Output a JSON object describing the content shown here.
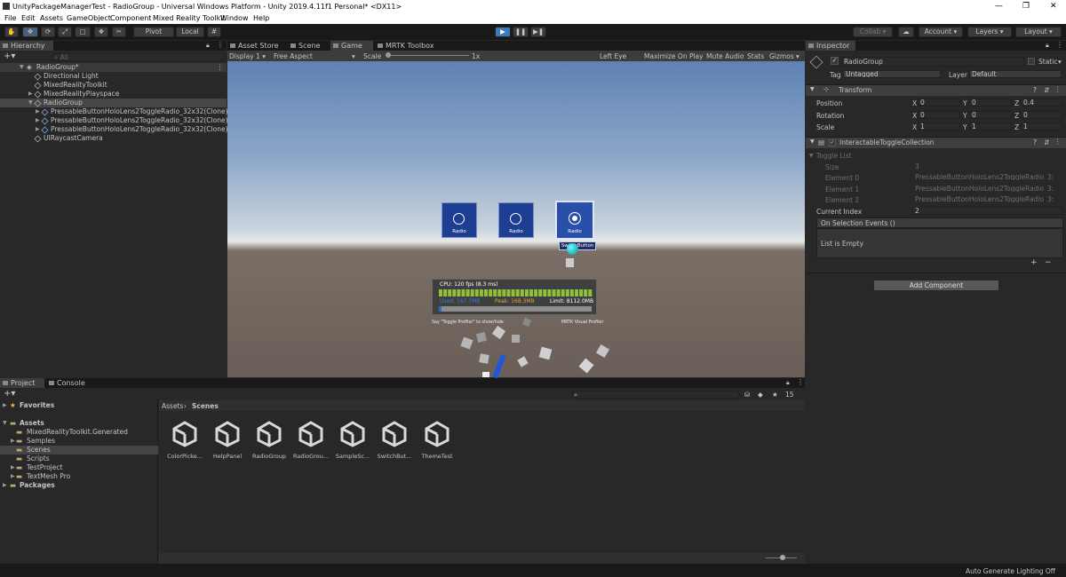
{
  "window": {
    "title": "UnityPackageManagerTest - RadioGroup - Universal Windows Platform - Unity 2019.4.11f1 Personal* <DX11>",
    "min": "—",
    "max": "❐",
    "close": "✕"
  },
  "menu": [
    "File",
    "Edit",
    "Assets",
    "GameObject",
    "Component",
    "Mixed Reality Toolkit",
    "Window",
    "Help"
  ],
  "toolbar": {
    "pivot": "Pivot",
    "local": "Local",
    "collab": "Collab ▾",
    "account": "Account",
    "layers": "Layers",
    "layout": "Layout"
  },
  "hierarchy": {
    "tab": "Hierarchy",
    "search_placeholder": "All",
    "root": "RadioGroup*",
    "items": [
      "Directional Light",
      "MixedRealityToolkit",
      "MixedRealityPlayspace",
      "RadioGroup",
      "PressableButtonHoloLens2ToggleRadio_32x32(Clone)",
      "PressableButtonHoloLens2ToggleRadio_32x32(Clone)",
      "PressableButtonHoloLens2ToggleRadio_32x32(Clone)",
      "UIRaycastCamera"
    ]
  },
  "center_tabs": [
    "Asset Store",
    "Scene",
    "Game",
    "MRTK Toolbox"
  ],
  "game_bar": {
    "display": "Display 1",
    "aspect": "Free Aspect",
    "scale_label": "Scale",
    "scale_value": "1x",
    "eye": "Left Eye",
    "maximize": "Maximize On Play",
    "mute": "Mute Audio",
    "stats": "Stats",
    "gizmos": "Gizmos"
  },
  "game_view": {
    "button_labels": [
      "Radio",
      "Radio",
      "Radio"
    ],
    "switch_tooltip": "SwitchButton",
    "profiler": {
      "cpu": "CPU: 120 fps (8.3 ms)",
      "used": "Used: 167.7MB",
      "peak": "Peak: 168.3MB",
      "limit": "Limit: 8112.0MB",
      "left_caption": "Say \"Toggle Profiler\" to show/hide",
      "right_caption": "MRTK Visual Profiler",
      "fps_fraction": 1.0,
      "memory_fraction": 0.02
    },
    "sky_top": "#6f8fb8",
    "ground": "#6a5f58"
  },
  "inspector": {
    "tab": "Inspector",
    "object_name": "RadioGroup",
    "static_label": "Static",
    "tag_label": "Tag",
    "tag_value": "Untagged",
    "layer_label": "Layer",
    "layer_value": "Default",
    "transform": {
      "title": "Transform",
      "rows": [
        {
          "label": "Position",
          "x": "0",
          "y": "0",
          "z": "0.4"
        },
        {
          "label": "Rotation",
          "x": "0",
          "y": "0",
          "z": "0"
        },
        {
          "label": "Scale",
          "x": "1",
          "y": "1",
          "z": "1"
        }
      ]
    },
    "component": {
      "title": "InteractableToggleCollection",
      "toggle_list": "Toggle List",
      "size_label": "Size",
      "size_value": "3",
      "elements": [
        {
          "label": "Element 0",
          "value": "PressableButtonHoloLens2ToggleRadio_3:"
        },
        {
          "label": "Element 1",
          "value": "PressableButtonHoloLens2ToggleRadio_3:"
        },
        {
          "label": "Element 2",
          "value": "PressableButtonHoloLens2ToggleRadio_3:"
        }
      ],
      "current_index_label": "Current Index",
      "current_index_value": "2",
      "events_label": "On Selection Events ()",
      "list_empty": "List is Empty"
    },
    "add_component": "Add Component"
  },
  "bottom": {
    "tabs": [
      "Project",
      "Console"
    ],
    "favorites": "Favorites",
    "assets": "Assets",
    "asset_folders": [
      "MixedRealityToolkit.Generated",
      "Samples",
      "Scenes",
      "Scripts",
      "TestProject",
      "TextMesh Pro"
    ],
    "packages": "Packages",
    "breadcrumb": [
      "Assets",
      "Scenes"
    ],
    "scene_files": [
      "ColorPicke...",
      "HelpPanel",
      "RadioGroup",
      "RadioGrou...",
      "SampleSc...",
      "SwitchBut...",
      "ThemeTest"
    ],
    "count": "15"
  },
  "status": {
    "right": "Auto Generate Lighting Off"
  },
  "colors": {
    "accent": "#3a79bb",
    "blue_button": "#1d3e91",
    "selection": "#2c5d87"
  }
}
